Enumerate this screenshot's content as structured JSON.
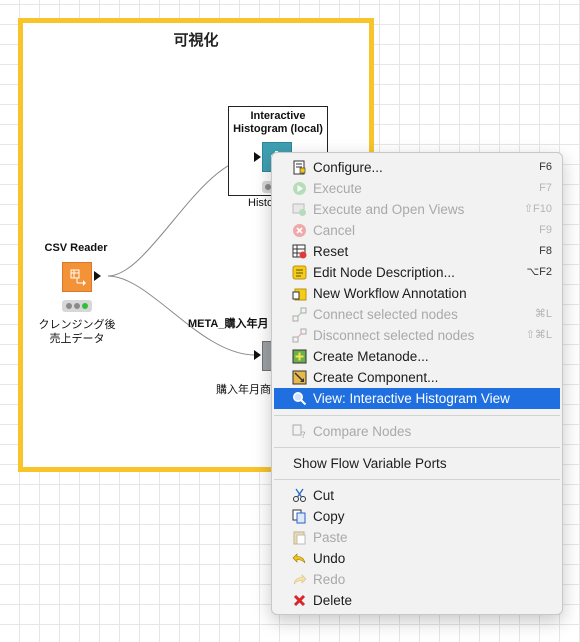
{
  "annotation": {
    "title": "可視化"
  },
  "nodes": {
    "csv_reader": {
      "name": "CSV Reader",
      "description_line1": "クレンジング後",
      "description_line2": "売上データ"
    },
    "histogram": {
      "name_line1": "Interactive",
      "name_line2": "Histogram (local)",
      "description": "Histo"
    },
    "metanode": {
      "name": "META_購入年月",
      "description": "購入年月商"
    }
  },
  "context_menu": {
    "items": [
      {
        "label": "Configure...",
        "shortcut": "F6",
        "icon": "configure-icon"
      },
      {
        "label": "Execute",
        "shortcut": "F7",
        "icon": "execute-icon",
        "disabled": true
      },
      {
        "label": "Execute and Open Views",
        "shortcut": "⇧F10",
        "icon": "execute-open-views-icon",
        "disabled": true
      },
      {
        "label": "Cancel",
        "shortcut": "F9",
        "icon": "cancel-icon",
        "disabled": true
      },
      {
        "label": "Reset",
        "shortcut": "F8",
        "icon": "reset-icon"
      },
      {
        "label": "Edit Node Description...",
        "shortcut": "⌥F2",
        "icon": "edit-description-icon"
      },
      {
        "label": "New Workflow Annotation",
        "shortcut": "",
        "icon": "annotation-icon"
      },
      {
        "label": "Connect selected nodes",
        "shortcut": "⌘L",
        "icon": "connect-nodes-icon",
        "disabled": true
      },
      {
        "label": "Disconnect selected nodes",
        "shortcut": "⇧⌘L",
        "icon": "disconnect-nodes-icon",
        "disabled": true
      },
      {
        "label": "Create Metanode...",
        "shortcut": "",
        "icon": "create-metanode-icon"
      },
      {
        "label": "Create Component...",
        "shortcut": "",
        "icon": "create-component-icon"
      },
      {
        "label": "View: Interactive Histogram View",
        "shortcut": "",
        "icon": "magnifier-icon",
        "selected": true
      },
      {
        "label": "Compare Nodes",
        "shortcut": "",
        "icon": "compare-nodes-icon",
        "disabled": true
      },
      {
        "label": "Show Flow Variable Ports",
        "shortcut": ""
      },
      {
        "label": "Cut",
        "shortcut": "",
        "icon": "cut-icon"
      },
      {
        "label": "Copy",
        "shortcut": "",
        "icon": "copy-icon"
      },
      {
        "label": "Paste",
        "shortcut": "",
        "icon": "paste-icon",
        "disabled": true
      },
      {
        "label": "Undo",
        "shortcut": "",
        "icon": "undo-icon"
      },
      {
        "label": "Redo",
        "shortcut": "",
        "icon": "redo-icon",
        "disabled": true
      },
      {
        "label": "Delete",
        "shortcut": "",
        "icon": "delete-icon"
      }
    ]
  },
  "colors": {
    "annotation_border": "#f8c42a",
    "csv_node": "#f39237",
    "histogram_node": "#3f9fb2",
    "menu_highlight": "#1f6fe0",
    "status_green": "#2fbf3a"
  }
}
